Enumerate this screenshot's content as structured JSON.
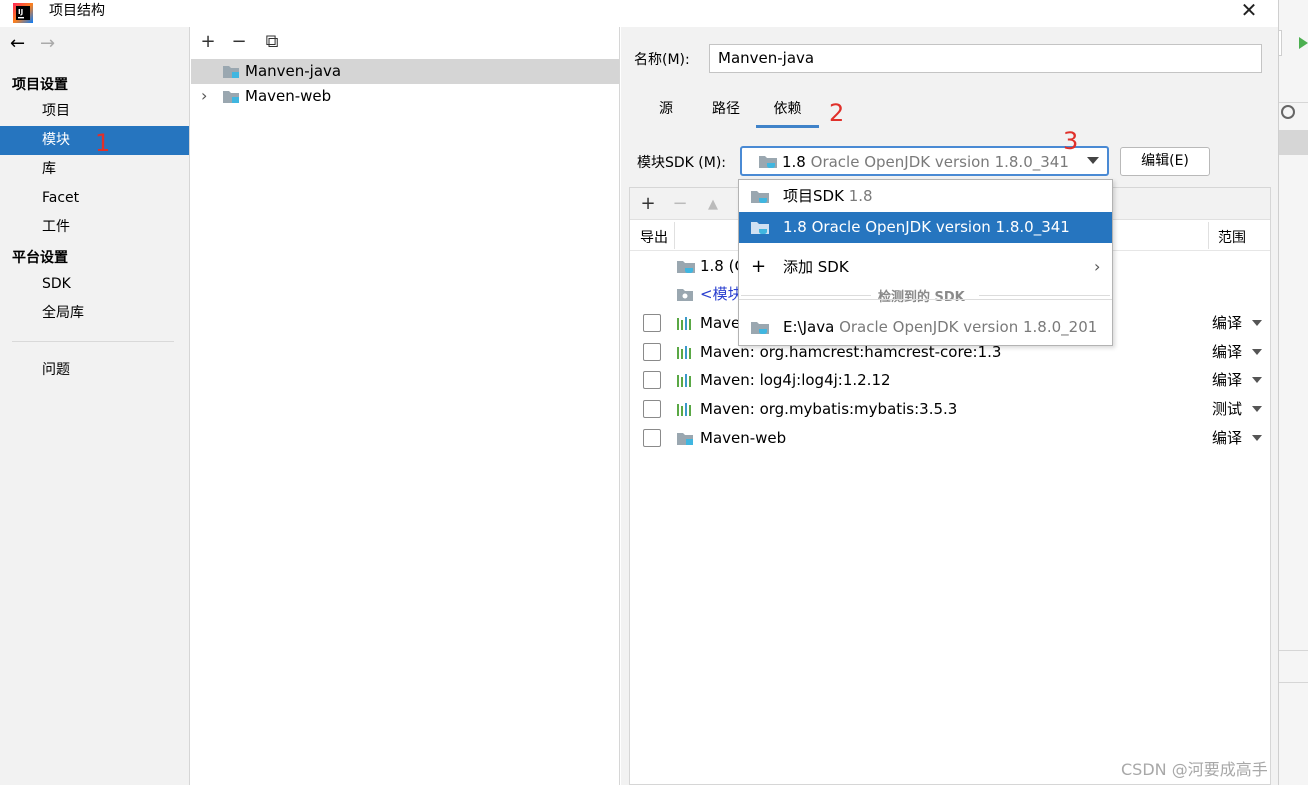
{
  "window": {
    "title": "项目结构"
  },
  "sidebar": {
    "back_icon": "←",
    "forward_icon": "→",
    "project_settings_header": "项目设置",
    "items": [
      "项目",
      "模块",
      "库",
      "Facet",
      "工件"
    ],
    "platform_settings_header": "平台设置",
    "platform_items": [
      "SDK",
      "全局库"
    ],
    "problems": "问题"
  },
  "tree": {
    "toolbar": {
      "add": "+",
      "remove": "−",
      "copy": "⧉"
    },
    "items": [
      {
        "label": "Manven-java",
        "selected": true
      },
      {
        "label": "Maven-web",
        "selected": false,
        "expand": "›"
      }
    ]
  },
  "detail": {
    "name_label": "名称(M):",
    "name_value": "Manven-java",
    "tabs": [
      "源",
      "路径",
      "依赖"
    ],
    "active_tab": "依赖",
    "sdk_label": "模块SDK (M):",
    "sdk_selected_version": "1.8",
    "sdk_selected_desc": "Oracle OpenJDK version 1.8.0_341",
    "edit_button": "编辑(E)",
    "dep_toolbar": {
      "add": "+",
      "remove": "−",
      "up": "▲"
    },
    "columns": {
      "export": "导出",
      "scope": "范围"
    },
    "deps": [
      {
        "text": "1.8 (C",
        "checkbox": false,
        "scope": ""
      },
      {
        "text": "<模块",
        "checkbox": false,
        "scope": ""
      },
      {
        "text": "Mave",
        "checkbox": true,
        "scope": "编译"
      },
      {
        "text": "Maven: org.hamcrest:hamcrest-core:1.3",
        "checkbox": true,
        "scope": "编译"
      },
      {
        "text": "Maven: log4j:log4j:1.2.12",
        "checkbox": true,
        "scope": "编译"
      },
      {
        "text": "Maven: org.mybatis:mybatis:3.5.3",
        "checkbox": true,
        "scope": "测试"
      },
      {
        "text": "Maven-web",
        "checkbox": true,
        "scope": "编译"
      }
    ]
  },
  "dropdown": {
    "items": [
      {
        "main": "项目SDK",
        "sub": "1.8"
      },
      {
        "main": "1.8 Oracle OpenJDK version 1.8.0_341",
        "sub": ""
      },
      {
        "main": "添加 SDK",
        "sub": ""
      }
    ],
    "detected_header": "检测到的 SDK",
    "detected": {
      "main": "E:\\Java",
      "sub": "Oracle OpenJDK version 1.8.0_201"
    }
  },
  "annotations": [
    "1",
    "2",
    "3"
  ],
  "watermark": "CSDN @河要成高手",
  "colors": {
    "selection": "#2675bf",
    "annotation": "#e0302a",
    "tab_underline": "#4083c9"
  }
}
